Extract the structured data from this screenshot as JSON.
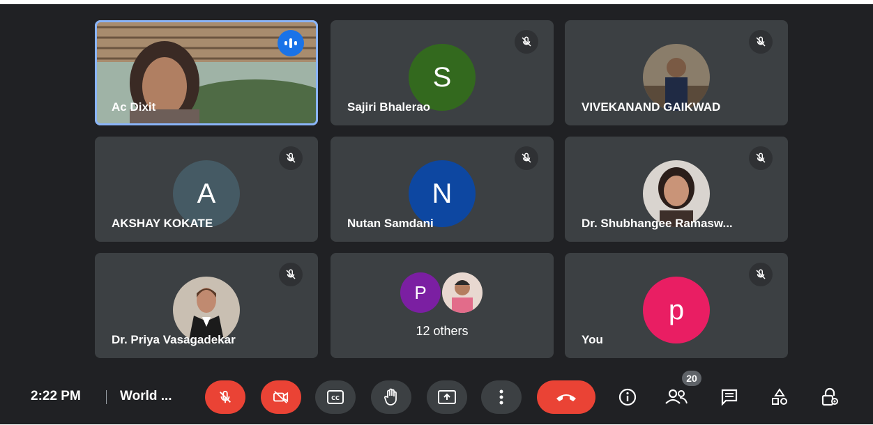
{
  "tiles": [
    {
      "name": "Ac Dixit",
      "type": "video",
      "speaking": true
    },
    {
      "name": "Sajiri Bhalerao",
      "initial": "S",
      "color": "#33691e"
    },
    {
      "name": "VIVEKANAND GAIKWAD",
      "type": "photo"
    },
    {
      "name": "AKSHAY KOKATE",
      "initial": "A",
      "color": "#455a64"
    },
    {
      "name": "Nutan Samdani",
      "initial": "N",
      "color": "#0d47a1"
    },
    {
      "name": "Dr. Shubhangee Ramasw...",
      "type": "photo"
    },
    {
      "name": "Dr. Priya Vasagadekar",
      "type": "photo"
    },
    {
      "name": "12 others",
      "initial": "P",
      "color": "#7b1fa2"
    },
    {
      "name": "You",
      "initial": "p",
      "color": "#e91e63"
    }
  ],
  "bar": {
    "time": "2:22 PM",
    "meeting": "World ...",
    "participant_count": "20"
  },
  "colors": {
    "background": "#202124",
    "tile": "#3c4043",
    "danger": "#ea4335",
    "highlight": "#8ab4f8"
  }
}
